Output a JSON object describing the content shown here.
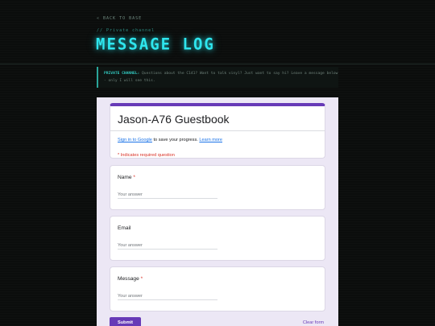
{
  "header": {
    "back_link": "« BACK TO BASE",
    "section_label": "// Private channel",
    "title": "MESSAGE LOG"
  },
  "notice": {
    "label": "PRIVATE CHANNEL:",
    "text": " Questions about the C141? Want to talk vinyl? Just want to say hi? Leave a message below - only I will see this."
  },
  "form": {
    "title": "Jason-A76 Guestbook",
    "signin_link": "Sign in to Google",
    "signin_middle": " to save your progress. ",
    "learn_more": "Learn more",
    "required_note": "* Indicates required question",
    "questions": [
      {
        "label": "Name",
        "required_mark": " *",
        "placeholder": "Your answer"
      },
      {
        "label": "Email",
        "required_mark": "",
        "placeholder": "Your answer"
      },
      {
        "label": "Message",
        "required_mark": " *",
        "placeholder": "Your answer"
      }
    ],
    "submit_label": "Submit",
    "clear_label": "Clear form"
  },
  "colors": {
    "accent_cyan": "#2ee6ee",
    "form_purple": "#673ab7",
    "required_red": "#d93025"
  }
}
